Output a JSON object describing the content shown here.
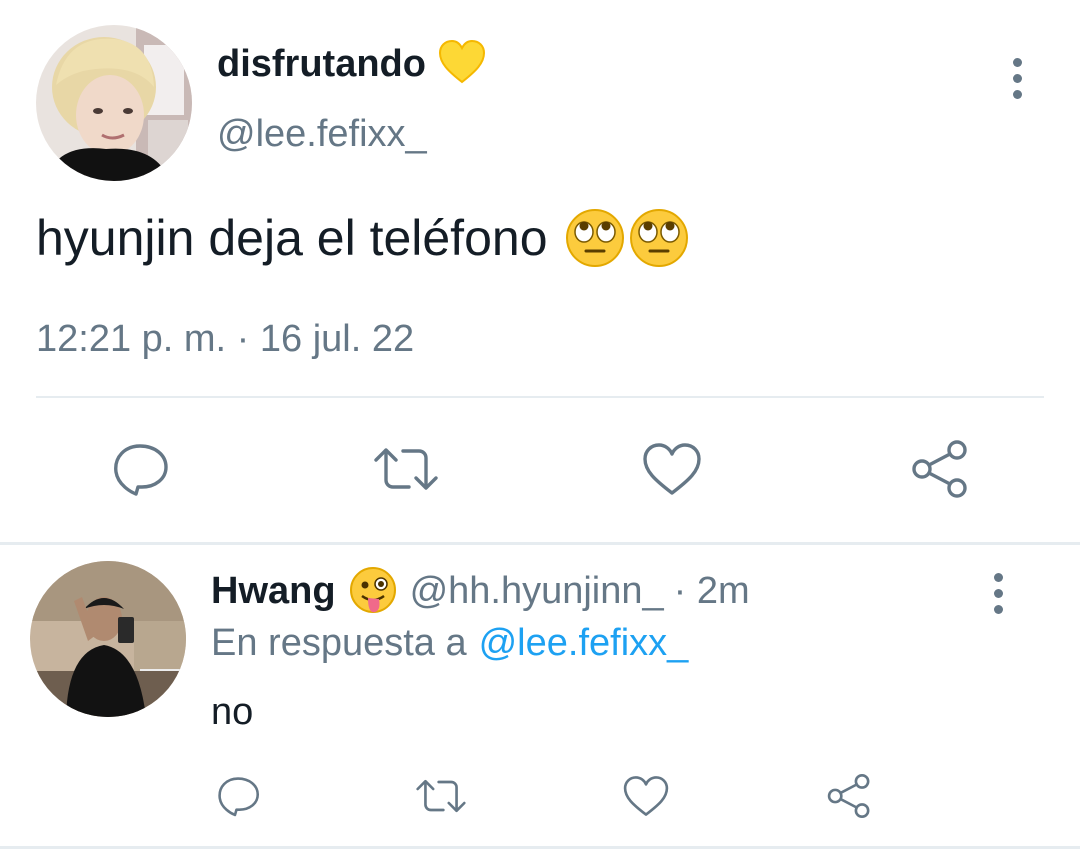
{
  "tweet": {
    "display_name": "disfrutando",
    "name_emoji": "yellow-heart",
    "handle": "@lee.fefixx_",
    "text": "hyunjin deja el teléfono",
    "text_emojis": [
      "face-with-rolling-eyes",
      "face-with-rolling-eyes"
    ],
    "timestamp": "12:21 p. m. · 16 jul. 22",
    "actions": [
      "reply-icon",
      "retweet-icon",
      "like-icon",
      "share-icon"
    ]
  },
  "reply": {
    "display_name": "Hwang",
    "name_emoji": "winking-face-with-tongue",
    "handle": "@hh.hyunjinn_",
    "time": "· 2m",
    "in_reply_prefix": "En respuesta a",
    "in_reply_handle": "@lee.fefixx_",
    "text": "no",
    "actions": [
      "reply-icon",
      "retweet-icon",
      "like-icon",
      "share-icon"
    ]
  },
  "colors": {
    "text": "#141d26",
    "muted": "#657786",
    "link": "#1da1f2",
    "divider": "#e6ecf0"
  }
}
